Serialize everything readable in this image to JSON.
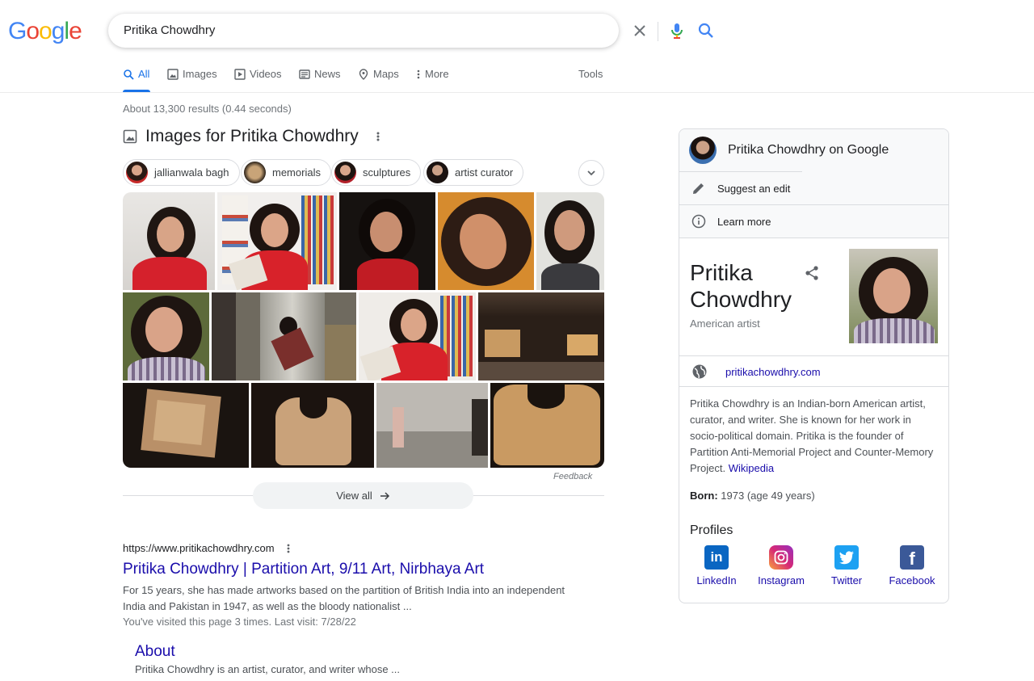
{
  "search": {
    "query": "Pritika Chowdhry"
  },
  "logo": {
    "text": [
      "G",
      "o",
      "o",
      "g",
      "l",
      "e"
    ],
    "colors": [
      "#4285f4",
      "#ea4335",
      "#fbbc05",
      "#4285f4",
      "#34a853",
      "#ea4335"
    ]
  },
  "tabs": [
    {
      "label": "All",
      "icon": "search-icon"
    },
    {
      "label": "Images",
      "icon": "image-icon"
    },
    {
      "label": "Videos",
      "icon": "play-icon"
    },
    {
      "label": "News",
      "icon": "news-icon"
    },
    {
      "label": "Maps",
      "icon": "map-pin-icon"
    },
    {
      "label": "More",
      "icon": "more-vert-icon"
    }
  ],
  "tools_label": "Tools",
  "stats": "About 13,300 results (0.44 seconds)",
  "images": {
    "title": "Images for Pritika Chowdhry",
    "chips": [
      "jallianwala bagh",
      "memorials",
      "sculptures",
      "artist curator"
    ],
    "feedback": "Feedback",
    "view_all": "View all"
  },
  "result": {
    "url": "https://www.pritikachowdhry.com",
    "title": "Pritika Chowdhry | Partition Art, 9/11 Art, Nirbhaya Art",
    "snippet": "For 15 years, she has made artworks based on the partition of British India into an independent India and Pakistan in 1947, as well as the bloody nationalist ...",
    "visited": "You've visited this page 3 times. Last visit: 7/28/22",
    "sublink_title": "About",
    "sublink_snippet": "Pritika Chowdhry is an artist, curator, and writer whose ..."
  },
  "panel": {
    "on_google": "Pritika Chowdhry on Google",
    "suggest_edit": "Suggest an edit",
    "learn_more": "Learn more",
    "name_line1": "Pritika",
    "name_line2": "Chowdhry",
    "subtitle": "American artist",
    "website": "pritikachowdhry.com",
    "description": "Pritika Chowdhry is an Indian-born American artist, curator, and writer. She is known for her work in socio-political domain. Pritika is the founder of Partition Anti-Memorial Project and Counter-Memory Project.",
    "wiki_link": "Wikipedia",
    "born_label": "Born:",
    "born_value": "1973 (age 49 years)",
    "profiles_title": "Profiles",
    "profiles": [
      {
        "label": "LinkedIn",
        "color": "#0a66c2",
        "glyph": "in"
      },
      {
        "label": "Instagram",
        "color": "#d62976",
        "glyph": "◎"
      },
      {
        "label": "Twitter",
        "color": "#1da1f2",
        "glyph": "t"
      },
      {
        "label": "Facebook",
        "color": "#3b5998",
        "glyph": "f"
      }
    ]
  }
}
